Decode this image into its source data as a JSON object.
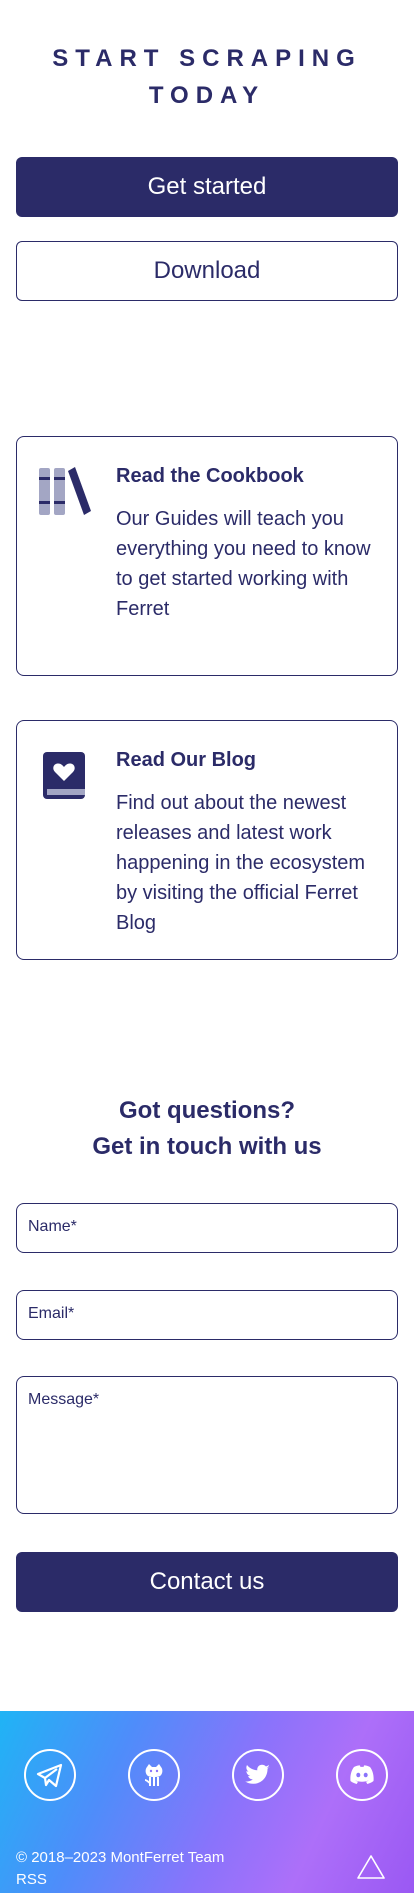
{
  "hero": {
    "title_line1": "START SCRAPING",
    "title_line2": "TODAY",
    "get_started_label": "Get started",
    "download_label": "Download"
  },
  "cards": [
    {
      "icon": "books-icon",
      "title": "Read the Cookbook",
      "text": "Our Guides will teach you everything you need to know to get started working with Ferret"
    },
    {
      "icon": "book-heart-icon",
      "title": "Read Our Blog",
      "text": "Find out about the newest releases and latest work happening in the ecosystem by visiting the official Ferret Blog"
    }
  ],
  "contact": {
    "title_line1": "Got questions?",
    "title_line2": "Get in touch with us",
    "name_placeholder": "Name*",
    "email_placeholder": "Email*",
    "message_placeholder": "Message*",
    "submit_label": "Contact us"
  },
  "footer": {
    "social": [
      "telegram-icon",
      "github-icon",
      "twitter-icon",
      "discord-icon"
    ],
    "copyright": "© 2018–2023 MontFerret Team",
    "rss_label": "RSS",
    "back_to_top_icon": "triangle-up-icon"
  },
  "colors": {
    "brand": "#2b2b68",
    "footer_gradient_start": "#1fb4f5",
    "footer_gradient_end": "#9a58f3"
  }
}
